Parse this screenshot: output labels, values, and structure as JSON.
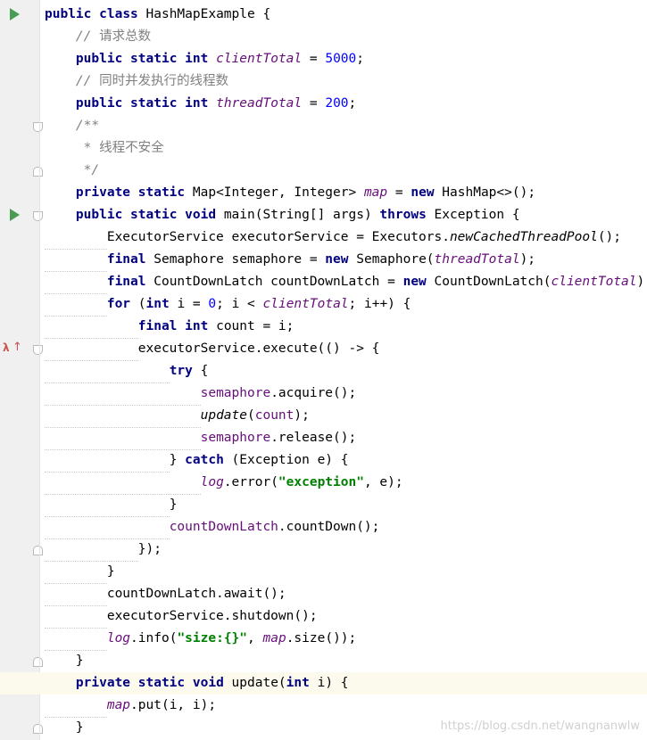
{
  "editor": {
    "lines": [
      [
        {
          "t": "public",
          "c": "kw"
        },
        {
          "t": " "
        },
        {
          "t": "class",
          "c": "kw"
        },
        {
          "t": " HashMapExample {"
        }
      ],
      [
        {
          "t": "    "
        },
        {
          "t": "// ",
          "c": "cm"
        },
        {
          "t": "请求总数",
          "c": "cm-cn"
        }
      ],
      [
        {
          "t": "    "
        },
        {
          "t": "public",
          "c": "kw"
        },
        {
          "t": " "
        },
        {
          "t": "static",
          "c": "kw"
        },
        {
          "t": " "
        },
        {
          "t": "int",
          "c": "kw"
        },
        {
          "t": " "
        },
        {
          "t": "clientTotal",
          "c": "sf"
        },
        {
          "t": " = "
        },
        {
          "t": "5000",
          "c": "num"
        },
        {
          "t": ";"
        }
      ],
      [
        {
          "t": "    "
        },
        {
          "t": "// ",
          "c": "cm"
        },
        {
          "t": "同时并发执行的线程数",
          "c": "cm-cn"
        }
      ],
      [
        {
          "t": "    "
        },
        {
          "t": "public",
          "c": "kw"
        },
        {
          "t": " "
        },
        {
          "t": "static",
          "c": "kw"
        },
        {
          "t": " "
        },
        {
          "t": "int",
          "c": "kw"
        },
        {
          "t": " "
        },
        {
          "t": "threadTotal",
          "c": "sf"
        },
        {
          "t": " = "
        },
        {
          "t": "200",
          "c": "num"
        },
        {
          "t": ";"
        }
      ],
      [
        {
          "t": "    "
        },
        {
          "t": "/**",
          "c": "cm"
        }
      ],
      [
        {
          "t": "     "
        },
        {
          "t": "* ",
          "c": "cm"
        },
        {
          "t": "线程不安全",
          "c": "cm-cn"
        }
      ],
      [
        {
          "t": "     "
        },
        {
          "t": "*/",
          "c": "cm"
        }
      ],
      [
        {
          "t": "    "
        },
        {
          "t": "private",
          "c": "kw"
        },
        {
          "t": " "
        },
        {
          "t": "static",
          "c": "kw"
        },
        {
          "t": " Map<Integer, Integer> "
        },
        {
          "t": "map",
          "c": "sf"
        },
        {
          "t": " = "
        },
        {
          "t": "new",
          "c": "kw"
        },
        {
          "t": " HashMap<>();"
        }
      ],
      [
        {
          "t": "    "
        },
        {
          "t": "public",
          "c": "kw"
        },
        {
          "t": " "
        },
        {
          "t": "static",
          "c": "kw"
        },
        {
          "t": " "
        },
        {
          "t": "void",
          "c": "kw"
        },
        {
          "t": " main(String[] args) "
        },
        {
          "t": "throws",
          "c": "kw"
        },
        {
          "t": " Exception {"
        }
      ],
      [
        {
          "t": "        ",
          "c": "ws"
        },
        {
          "t": "ExecutorService executorService = Executors."
        },
        {
          "t": "newCachedThreadPool",
          "c": "sm"
        },
        {
          "t": "();"
        }
      ],
      [
        {
          "t": "        ",
          "c": "ws"
        },
        {
          "t": "final",
          "c": "kw"
        },
        {
          "t": " Semaphore semaphore = "
        },
        {
          "t": "new",
          "c": "kw"
        },
        {
          "t": " Semaphore("
        },
        {
          "t": "threadTotal",
          "c": "sf"
        },
        {
          "t": ");"
        }
      ],
      [
        {
          "t": "        ",
          "c": "ws"
        },
        {
          "t": "final",
          "c": "kw"
        },
        {
          "t": " CountDownLatch countDownLatch = "
        },
        {
          "t": "new",
          "c": "kw"
        },
        {
          "t": " CountDownLatch("
        },
        {
          "t": "clientTotal",
          "c": "sf"
        },
        {
          "t": ");"
        }
      ],
      [
        {
          "t": "        ",
          "c": "ws"
        },
        {
          "t": "for",
          "c": "kw"
        },
        {
          "t": " ("
        },
        {
          "t": "int",
          "c": "kw"
        },
        {
          "t": " i = "
        },
        {
          "t": "0",
          "c": "num"
        },
        {
          "t": "; i < "
        },
        {
          "t": "clientTotal",
          "c": "sf"
        },
        {
          "t": "; i++) {"
        }
      ],
      [
        {
          "t": "            ",
          "c": "ws"
        },
        {
          "t": "final",
          "c": "kw"
        },
        {
          "t": " "
        },
        {
          "t": "int",
          "c": "kw"
        },
        {
          "t": " count = i;"
        }
      ],
      [
        {
          "t": "            ",
          "c": "ws"
        },
        {
          "t": "executorService.execute(() -> {"
        }
      ],
      [
        {
          "t": "                ",
          "c": "ws"
        },
        {
          "t": "try",
          "c": "kw"
        },
        {
          "t": " {"
        }
      ],
      [
        {
          "t": "                    ",
          "c": "ws"
        },
        {
          "t": "semaphore",
          "c": "fld"
        },
        {
          "t": ".acquire();"
        }
      ],
      [
        {
          "t": "                    ",
          "c": "ws"
        },
        {
          "t": "update",
          "c": "sm"
        },
        {
          "t": "("
        },
        {
          "t": "count",
          "c": "fld"
        },
        {
          "t": ");"
        }
      ],
      [
        {
          "t": "                    ",
          "c": "ws"
        },
        {
          "t": "semaphore",
          "c": "fld"
        },
        {
          "t": ".release();"
        }
      ],
      [
        {
          "t": "                ",
          "c": "ws"
        },
        {
          "t": "} "
        },
        {
          "t": "catch",
          "c": "kw"
        },
        {
          "t": " (Exception e) {"
        }
      ],
      [
        {
          "t": "                    ",
          "c": "ws"
        },
        {
          "t": "log",
          "c": "sf"
        },
        {
          "t": ".error("
        },
        {
          "t": "\"exception\"",
          "c": "str"
        },
        {
          "t": ", e);"
        }
      ],
      [
        {
          "t": "                ",
          "c": "ws"
        },
        {
          "t": "}"
        }
      ],
      [
        {
          "t": "                ",
          "c": "ws"
        },
        {
          "t": "countDownLatch",
          "c": "fld"
        },
        {
          "t": ".countDown();"
        }
      ],
      [
        {
          "t": "            ",
          "c": "ws"
        },
        {
          "t": "});"
        }
      ],
      [
        {
          "t": "        ",
          "c": "ws"
        },
        {
          "t": "}"
        }
      ],
      [
        {
          "t": "        ",
          "c": "ws"
        },
        {
          "t": "countDownLatch.await();"
        }
      ],
      [
        {
          "t": "        ",
          "c": "ws"
        },
        {
          "t": "executorService.shutdown();"
        }
      ],
      [
        {
          "t": "        ",
          "c": "ws"
        },
        {
          "t": "log",
          "c": "sf"
        },
        {
          "t": ".info("
        },
        {
          "t": "\"size:{}\"",
          "c": "str"
        },
        {
          "t": ", "
        },
        {
          "t": "map",
          "c": "sf"
        },
        {
          "t": ".size());"
        }
      ],
      [
        {
          "t": "    "
        },
        {
          "t": "}"
        }
      ],
      [
        {
          "t": "    "
        },
        {
          "t": "private",
          "c": "kw"
        },
        {
          "t": " "
        },
        {
          "t": "static",
          "c": "kw"
        },
        {
          "t": " "
        },
        {
          "t": "void",
          "c": "kw"
        },
        {
          "t": " update("
        },
        {
          "t": "int",
          "c": "kw"
        },
        {
          "t": " i) {"
        }
      ],
      [
        {
          "t": "        ",
          "c": "ws"
        },
        {
          "t": "map",
          "c": "sf"
        },
        {
          "t": ".put(i, i);"
        }
      ],
      [
        {
          "t": "    "
        },
        {
          "t": "}"
        }
      ]
    ],
    "current_line": 30,
    "gutter": [
      {
        "line": 0,
        "icon": "run-icon"
      },
      {
        "line": 5,
        "icon": "fold-open-icon"
      },
      {
        "line": 7,
        "icon": "fold-close-icon"
      },
      {
        "line": 9,
        "icon": "run-icon"
      },
      {
        "line": 9,
        "icon": "fold-open-icon"
      },
      {
        "line": 15,
        "icon": "lambda-icon"
      },
      {
        "line": 15,
        "icon": "arrow-up-icon"
      },
      {
        "line": 15,
        "icon": "fold-open-icon"
      },
      {
        "line": 24,
        "icon": "fold-close-icon"
      },
      {
        "line": 29,
        "icon": "fold-close-icon"
      },
      {
        "line": 30,
        "icon": "fold-open-icon"
      },
      {
        "line": 32,
        "icon": "fold-close-icon"
      }
    ],
    "gutter_glyphs": {
      "lambda": "λ",
      "arrow_up": "↑"
    }
  },
  "watermark": "https://blog.csdn.net/wangnanwlw"
}
